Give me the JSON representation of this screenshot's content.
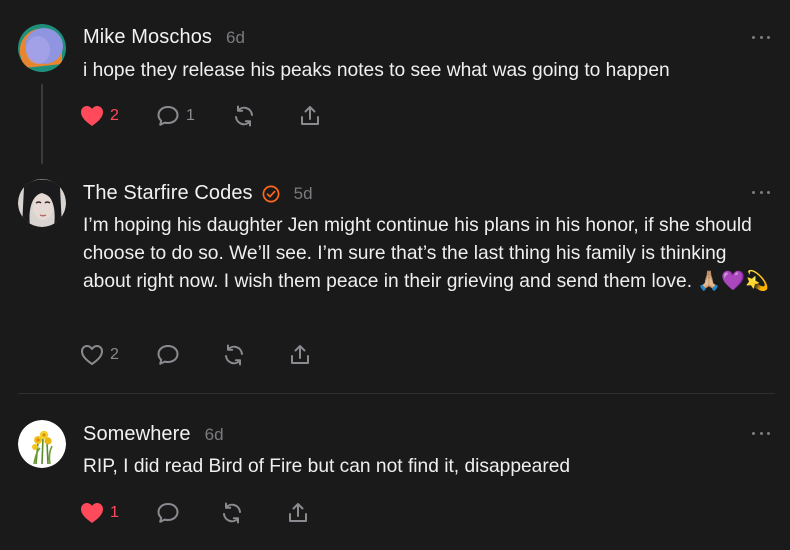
{
  "comments": [
    {
      "author": "Mike Moschos",
      "time": "6d",
      "text": "i hope they release his peaks notes to see what was going to happen",
      "likes": "2",
      "replies": "1",
      "liked": true
    },
    {
      "author": "The Starfire Codes",
      "time": "5d",
      "text": "I’m hoping his daughter Jen might continue his plans in his honor, if she should choose to do so. We’ll see. I’m sure that’s the last thing his family is thinking about right now. I wish them peace in their grieving and send them love. 🙏🏼💜💫",
      "likes": "2",
      "replies": "",
      "liked": false,
      "verified": true
    },
    {
      "author": "Somewhere",
      "time": "6d",
      "text": "RIP, I did read Bird of Fire but can not find it, disappeared",
      "likes": "1",
      "replies": "",
      "liked": true
    }
  ],
  "colors": {
    "background": "#1a1a1b",
    "like_red": "#ff4a5b",
    "verified_orange": "#ff6719",
    "icon_gray": "#8a8a8f"
  },
  "icons": [
    "heart-icon",
    "comment-icon",
    "restack-icon",
    "share-icon",
    "more-icon",
    "verified-icon"
  ]
}
